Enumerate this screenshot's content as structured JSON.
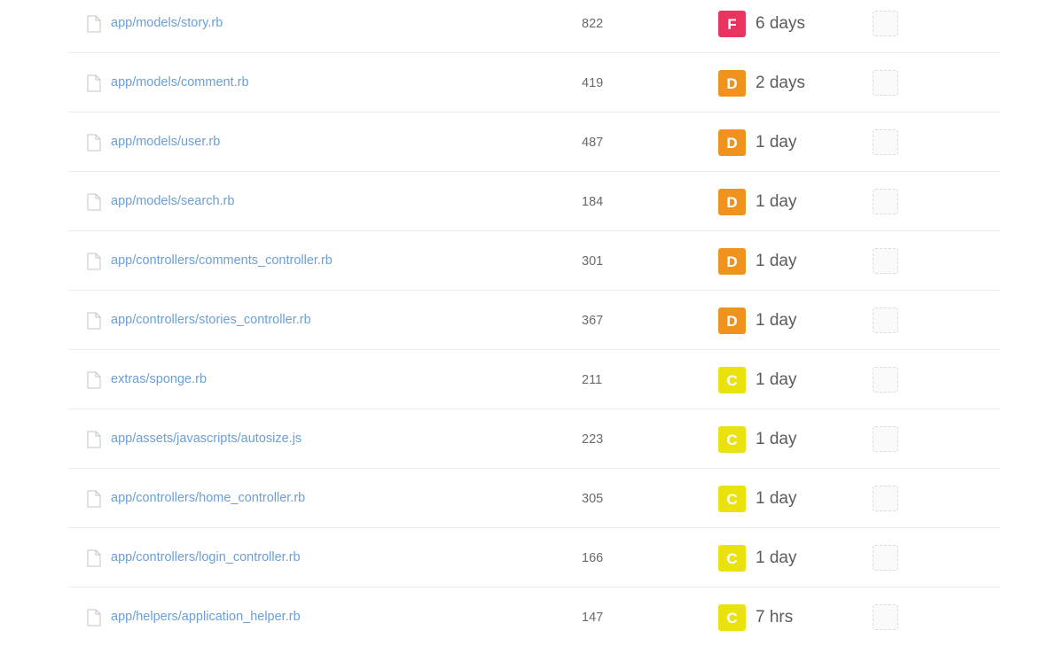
{
  "colors": {
    "grade_F": "#e8345e",
    "grade_D": "#f0931e",
    "grade_C": "#e9e20c",
    "link": "#6b9fd6"
  },
  "icons": {
    "file": "file-icon",
    "coverage": "coverage-placeholder"
  },
  "rows": [
    {
      "path": "app/models/story.rb",
      "loc": "822",
      "grade": "F",
      "age": "6 days"
    },
    {
      "path": "app/models/comment.rb",
      "loc": "419",
      "grade": "D",
      "age": "2 days"
    },
    {
      "path": "app/models/user.rb",
      "loc": "487",
      "grade": "D",
      "age": "1 day"
    },
    {
      "path": "app/models/search.rb",
      "loc": "184",
      "grade": "D",
      "age": "1 day"
    },
    {
      "path": "app/controllers/comments_controller.rb",
      "loc": "301",
      "grade": "D",
      "age": "1 day"
    },
    {
      "path": "app/controllers/stories_controller.rb",
      "loc": "367",
      "grade": "D",
      "age": "1 day"
    },
    {
      "path": "extras/sponge.rb",
      "loc": "211",
      "grade": "C",
      "age": "1 day"
    },
    {
      "path": "app/assets/javascripts/autosize.js",
      "loc": "223",
      "grade": "C",
      "age": "1 day"
    },
    {
      "path": "app/controllers/home_controller.rb",
      "loc": "305",
      "grade": "C",
      "age": "1 day"
    },
    {
      "path": "app/controllers/login_controller.rb",
      "loc": "166",
      "grade": "C",
      "age": "1 day"
    },
    {
      "path": "app/helpers/application_helper.rb",
      "loc": "147",
      "grade": "C",
      "age": "7 hrs"
    }
  ]
}
